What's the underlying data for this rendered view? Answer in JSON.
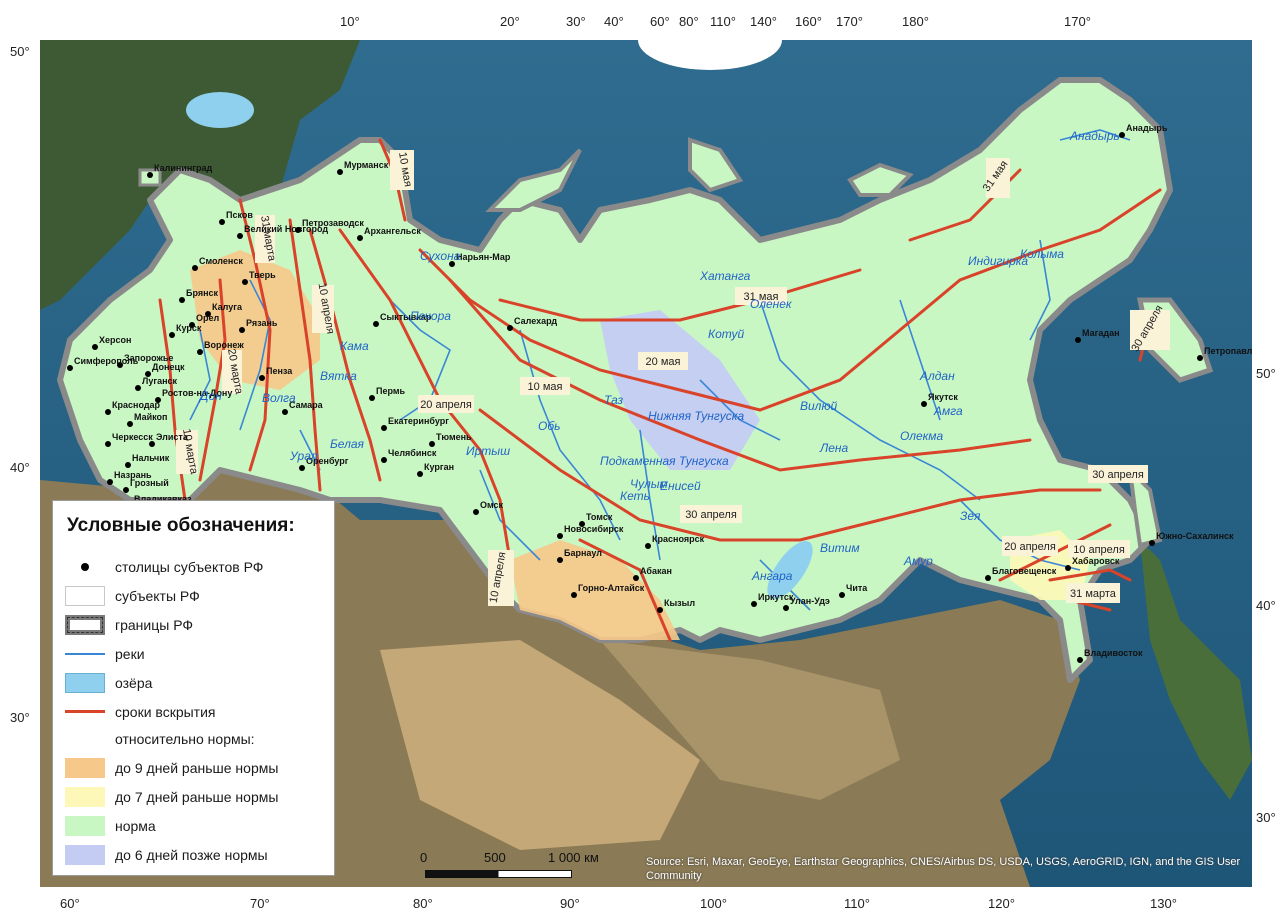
{
  "legend": {
    "title": "Условные обозначения:",
    "items": {
      "capitals": "столицы субъектов РФ",
      "subjects": "субъекты РФ",
      "borders": "границы РФ",
      "rivers": "реки",
      "lakes": "озёра",
      "breakup_lines": "сроки вскрытия",
      "relative_header": "относительно нормы:",
      "early9": "до 9 дней раньше нормы",
      "early7": "до 7 дней раньше нормы",
      "norm": "норма",
      "late6": "до 6 дней позже нормы"
    },
    "colors": {
      "capitals": "#000000",
      "rivers": "#3a86d6",
      "lakes": "#8fd0ee",
      "breakup_lines": "#d9432a",
      "early9": "#f6c88a",
      "early7": "#fdf7b8",
      "norm": "#c9f7c4",
      "late6": "#c4ccf4"
    }
  },
  "scale_bar": {
    "labels": [
      "0",
      "500",
      "1 000 км"
    ]
  },
  "source": "Source: Esri, Maxar, GeoEye, Earthstar Geographics, CNES/Airbus DS, USDA, USGS, AeroGRID, IGN, and the GIS User Community",
  "graticule": {
    "top": [
      "10°",
      "20°",
      "30°",
      "40°",
      "60°",
      "80°",
      "110°",
      "140°",
      "160°",
      "170°",
      "180°",
      "170°"
    ],
    "bottom": [
      "60°",
      "70°",
      "80°",
      "90°",
      "100°",
      "110°",
      "120°",
      "130°"
    ],
    "left": [
      "50°",
      "40°",
      "30°"
    ],
    "right": [
      "50°",
      "40°",
      "30°"
    ]
  },
  "breakup_labels": [
    "10 мая",
    "31 марта",
    "10 апреля",
    "20 марта",
    "10 марта",
    "20 апреля",
    "10 мая",
    "20 мая",
    "31 мая",
    "31 мая",
    "30 апреля",
    "30 апреля",
    "30 апреля",
    "10 апреля",
    "20 апреля",
    "10 апреля",
    "31 марта"
  ],
  "cities": [
    "Калининград",
    "Мурманск",
    "Псков",
    "Великий Новгород",
    "Петрозаводск",
    "Архангельск",
    "Нарьян-Мар",
    "Смоленск",
    "Тверь",
    "Брянск",
    "Калуга",
    "Орел",
    "Курск",
    "Рязань",
    "Херсон",
    "Воронеж",
    "Запорожье",
    "Симферополь",
    "Донецк",
    "Луганск",
    "Ростов-на-Дону",
    "Пенза",
    "Самара",
    "Краснодар",
    "Майкоп",
    "Черкесск",
    "Элиста",
    "Нальчик",
    "Назрань",
    "Грозный",
    "Владикавказ",
    "Сыктывкар",
    "Пермь",
    "Екатеринбург",
    "Тюмень",
    "Челябинск",
    "Курган",
    "Оренбург",
    "Салехард",
    "Омск",
    "Новосибирск",
    "Томск",
    "Барнаул",
    "Горно-Алтайск",
    "Абакан",
    "Кызыл",
    "Красноярск",
    "Иркутск",
    "Улан-Удэ",
    "Чита",
    "Якутск",
    "Благовещенск",
    "Хабаровск",
    "Владивосток",
    "Южно-Сахалинск",
    "Магадан",
    "Петропавловск-Камчатский",
    "Анадырь"
  ],
  "rivers": [
    "Печора",
    "Кама",
    "Волга",
    "Дон",
    "Урал",
    "Белая",
    "Обь",
    "Иртыш",
    "Таз",
    "Енисей",
    "Кеть",
    "Чулым",
    "Подкаменная Тунгуска",
    "Нижняя Тунгуска",
    "Котуй",
    "Оленек",
    "Хатанга",
    "Вилюй",
    "Лена",
    "Алдан",
    "Амга",
    "Индигирка",
    "Колыма",
    "Анадырь",
    "Витим",
    "Олекма",
    "Зея",
    "Амур",
    "Ангара",
    "Сухона",
    "Вятка"
  ]
}
